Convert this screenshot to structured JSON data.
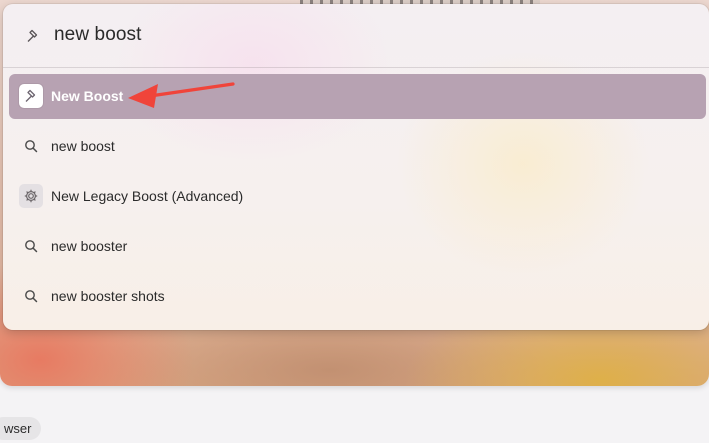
{
  "search": {
    "query": "new boost",
    "icon": "boost-hammer-icon"
  },
  "results": [
    {
      "label": "New Boost",
      "icon": "boost-hammer-icon",
      "selected": true
    },
    {
      "label": "new boost",
      "icon": "search-icon",
      "selected": false
    },
    {
      "label": "New Legacy Boost (Advanced)",
      "icon": "gear-icon",
      "selected": false
    },
    {
      "label": "new booster",
      "icon": "search-icon",
      "selected": false
    },
    {
      "label": "new booster shots",
      "icon": "search-icon",
      "selected": false
    }
  ],
  "annotation": {
    "arrow_color": "#f0443a",
    "points_to": "New Boost"
  },
  "bottom_bar": {
    "chip_text": "wser"
  },
  "colors": {
    "selected_row": "#b7a2b2",
    "selected_text": "#ffffff"
  }
}
